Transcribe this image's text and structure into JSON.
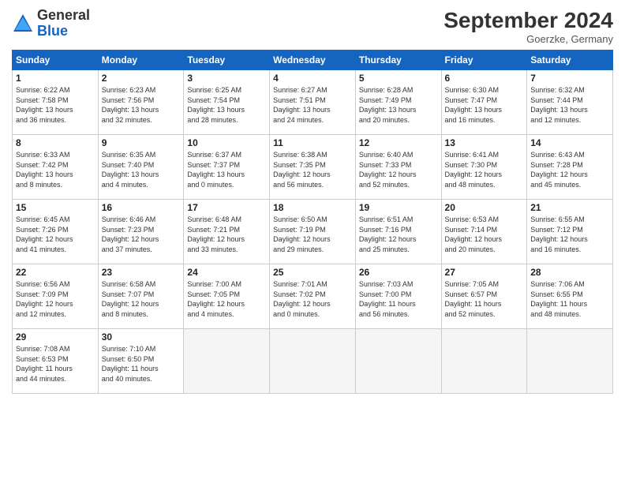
{
  "header": {
    "logo_general": "General",
    "logo_blue": "Blue",
    "month_title": "September 2024",
    "location": "Goerzke, Germany"
  },
  "days_of_week": [
    "Sunday",
    "Monday",
    "Tuesday",
    "Wednesday",
    "Thursday",
    "Friday",
    "Saturday"
  ],
  "weeks": [
    [
      {
        "day": "1",
        "info": "Sunrise: 6:22 AM\nSunset: 7:58 PM\nDaylight: 13 hours\nand 36 minutes."
      },
      {
        "day": "2",
        "info": "Sunrise: 6:23 AM\nSunset: 7:56 PM\nDaylight: 13 hours\nand 32 minutes."
      },
      {
        "day": "3",
        "info": "Sunrise: 6:25 AM\nSunset: 7:54 PM\nDaylight: 13 hours\nand 28 minutes."
      },
      {
        "day": "4",
        "info": "Sunrise: 6:27 AM\nSunset: 7:51 PM\nDaylight: 13 hours\nand 24 minutes."
      },
      {
        "day": "5",
        "info": "Sunrise: 6:28 AM\nSunset: 7:49 PM\nDaylight: 13 hours\nand 20 minutes."
      },
      {
        "day": "6",
        "info": "Sunrise: 6:30 AM\nSunset: 7:47 PM\nDaylight: 13 hours\nand 16 minutes."
      },
      {
        "day": "7",
        "info": "Sunrise: 6:32 AM\nSunset: 7:44 PM\nDaylight: 13 hours\nand 12 minutes."
      }
    ],
    [
      {
        "day": "8",
        "info": "Sunrise: 6:33 AM\nSunset: 7:42 PM\nDaylight: 13 hours\nand 8 minutes."
      },
      {
        "day": "9",
        "info": "Sunrise: 6:35 AM\nSunset: 7:40 PM\nDaylight: 13 hours\nand 4 minutes."
      },
      {
        "day": "10",
        "info": "Sunrise: 6:37 AM\nSunset: 7:37 PM\nDaylight: 13 hours\nand 0 minutes."
      },
      {
        "day": "11",
        "info": "Sunrise: 6:38 AM\nSunset: 7:35 PM\nDaylight: 12 hours\nand 56 minutes."
      },
      {
        "day": "12",
        "info": "Sunrise: 6:40 AM\nSunset: 7:33 PM\nDaylight: 12 hours\nand 52 minutes."
      },
      {
        "day": "13",
        "info": "Sunrise: 6:41 AM\nSunset: 7:30 PM\nDaylight: 12 hours\nand 48 minutes."
      },
      {
        "day": "14",
        "info": "Sunrise: 6:43 AM\nSunset: 7:28 PM\nDaylight: 12 hours\nand 45 minutes."
      }
    ],
    [
      {
        "day": "15",
        "info": "Sunrise: 6:45 AM\nSunset: 7:26 PM\nDaylight: 12 hours\nand 41 minutes."
      },
      {
        "day": "16",
        "info": "Sunrise: 6:46 AM\nSunset: 7:23 PM\nDaylight: 12 hours\nand 37 minutes."
      },
      {
        "day": "17",
        "info": "Sunrise: 6:48 AM\nSunset: 7:21 PM\nDaylight: 12 hours\nand 33 minutes."
      },
      {
        "day": "18",
        "info": "Sunrise: 6:50 AM\nSunset: 7:19 PM\nDaylight: 12 hours\nand 29 minutes."
      },
      {
        "day": "19",
        "info": "Sunrise: 6:51 AM\nSunset: 7:16 PM\nDaylight: 12 hours\nand 25 minutes."
      },
      {
        "day": "20",
        "info": "Sunrise: 6:53 AM\nSunset: 7:14 PM\nDaylight: 12 hours\nand 20 minutes."
      },
      {
        "day": "21",
        "info": "Sunrise: 6:55 AM\nSunset: 7:12 PM\nDaylight: 12 hours\nand 16 minutes."
      }
    ],
    [
      {
        "day": "22",
        "info": "Sunrise: 6:56 AM\nSunset: 7:09 PM\nDaylight: 12 hours\nand 12 minutes."
      },
      {
        "day": "23",
        "info": "Sunrise: 6:58 AM\nSunset: 7:07 PM\nDaylight: 12 hours\nand 8 minutes."
      },
      {
        "day": "24",
        "info": "Sunrise: 7:00 AM\nSunset: 7:05 PM\nDaylight: 12 hours\nand 4 minutes."
      },
      {
        "day": "25",
        "info": "Sunrise: 7:01 AM\nSunset: 7:02 PM\nDaylight: 12 hours\nand 0 minutes."
      },
      {
        "day": "26",
        "info": "Sunrise: 7:03 AM\nSunset: 7:00 PM\nDaylight: 11 hours\nand 56 minutes."
      },
      {
        "day": "27",
        "info": "Sunrise: 7:05 AM\nSunset: 6:57 PM\nDaylight: 11 hours\nand 52 minutes."
      },
      {
        "day": "28",
        "info": "Sunrise: 7:06 AM\nSunset: 6:55 PM\nDaylight: 11 hours\nand 48 minutes."
      }
    ],
    [
      {
        "day": "29",
        "info": "Sunrise: 7:08 AM\nSunset: 6:53 PM\nDaylight: 11 hours\nand 44 minutes."
      },
      {
        "day": "30",
        "info": "Sunrise: 7:10 AM\nSunset: 6:50 PM\nDaylight: 11 hours\nand 40 minutes."
      },
      {
        "day": "",
        "info": ""
      },
      {
        "day": "",
        "info": ""
      },
      {
        "day": "",
        "info": ""
      },
      {
        "day": "",
        "info": ""
      },
      {
        "day": "",
        "info": ""
      }
    ]
  ]
}
